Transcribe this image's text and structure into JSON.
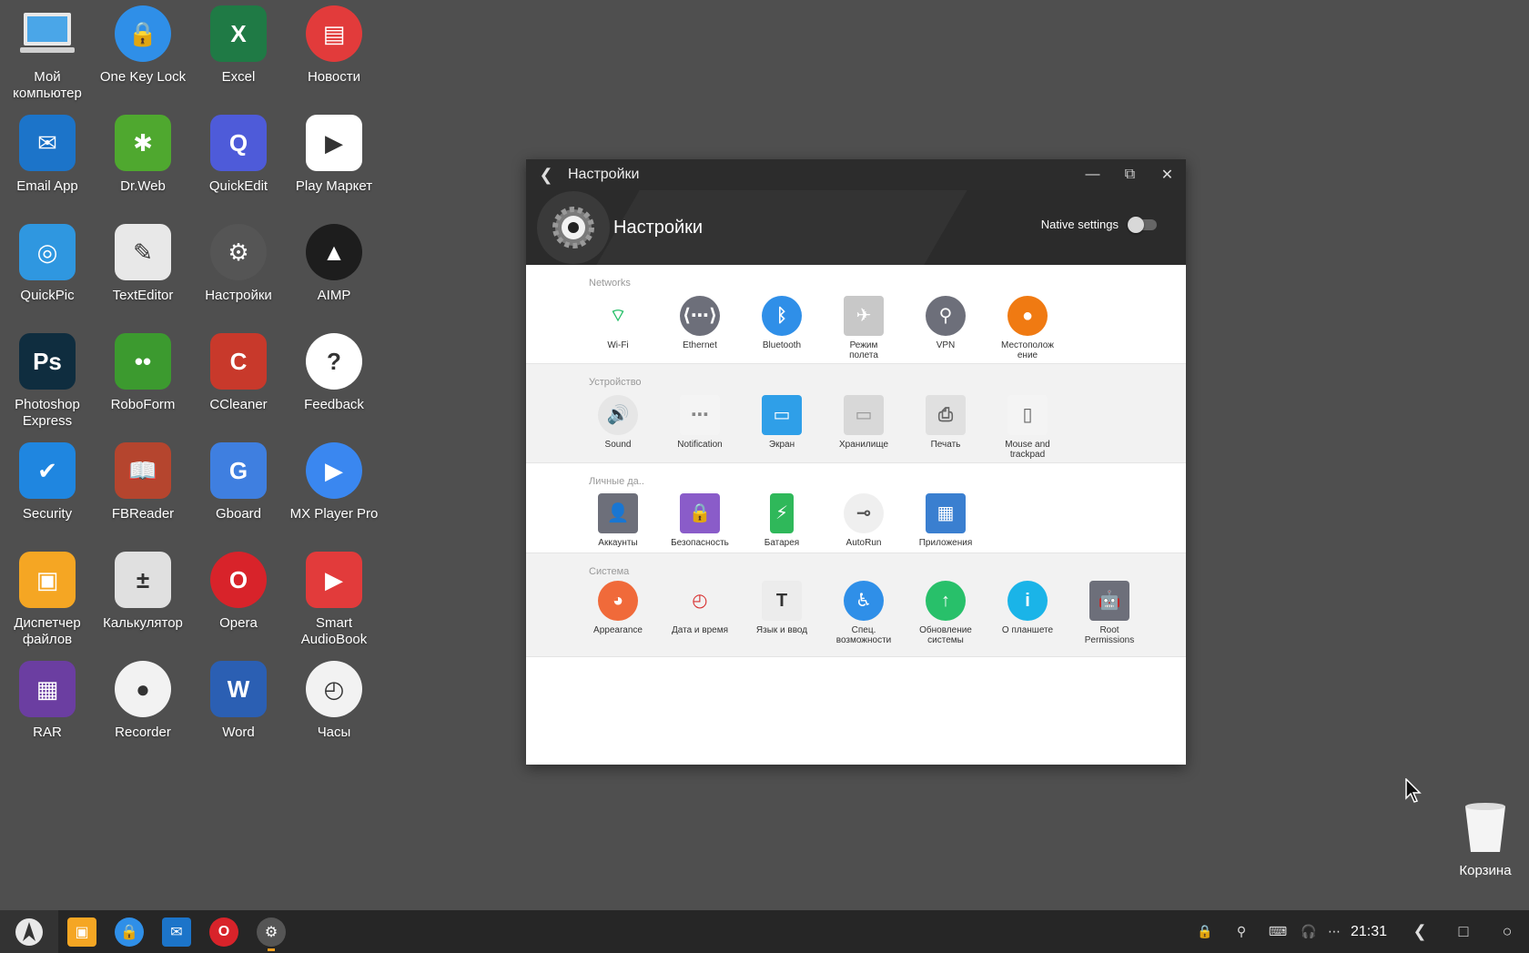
{
  "desktop": {
    "icons": [
      {
        "label": "Мой\nкомпьютер",
        "icon": "computer-icon",
        "color": "#4aa6e8"
      },
      {
        "label": "One Key Lock",
        "icon": "lock-icon",
        "color": "#2f8fe8"
      },
      {
        "label": "Excel",
        "icon": "excel-icon",
        "color": "#1f7a45"
      },
      {
        "label": "Новости",
        "icon": "news-icon",
        "color": "#e23b3b"
      },
      {
        "label": "Email App",
        "icon": "mail-icon",
        "color": "#1c74c9"
      },
      {
        "label": "Dr.Web",
        "icon": "spider-icon",
        "color": "#4fa82f"
      },
      {
        "label": "QuickEdit",
        "icon": "edit-icon",
        "color": "#4e5bd9"
      },
      {
        "label": "Play Маркет",
        "icon": "play-store-icon",
        "color": "#ffffff"
      },
      {
        "label": "QuickPic",
        "icon": "picture-icon",
        "color": "#2f97e0"
      },
      {
        "label": "TextEditor",
        "icon": "pen-icon",
        "color": "#e8e8e8"
      },
      {
        "label": "Настройки",
        "icon": "gear-icon",
        "color": "#555555"
      },
      {
        "label": "AIMP",
        "icon": "aimp-icon",
        "color": "#1d1d1d"
      },
      {
        "label": "Photoshop\nExpress",
        "icon": "photoshop-icon",
        "color": "#0f2d3f"
      },
      {
        "label": "RoboForm",
        "icon": "roboform-icon",
        "color": "#3c9a2f"
      },
      {
        "label": "CCleaner",
        "icon": "ccleaner-icon",
        "color": "#c8392b"
      },
      {
        "label": "Feedback",
        "icon": "question-icon",
        "color": "#ffffff"
      },
      {
        "label": "Security",
        "icon": "shield-icon",
        "color": "#1f86e0"
      },
      {
        "label": "FBReader",
        "icon": "book-icon",
        "color": "#b5452e"
      },
      {
        "label": "Gboard",
        "icon": "keyboard-icon",
        "color": "#3f7fe0"
      },
      {
        "label": "MX Player Pro",
        "icon": "play-icon",
        "color": "#3a87f0"
      },
      {
        "label": "Диспетчер\nфайлов",
        "icon": "folder-icon",
        "color": "#f5a623"
      },
      {
        "label": "Калькулятор",
        "icon": "calculator-icon",
        "color": "#e0e0e0"
      },
      {
        "label": "Opera",
        "icon": "opera-icon",
        "color": "#d8232a"
      },
      {
        "label": "Smart\nAudioBook",
        "icon": "audiobook-icon",
        "color": "#e23b3b"
      },
      {
        "label": "RAR",
        "icon": "rar-icon",
        "color": "#6b3ea1"
      },
      {
        "label": "Recorder",
        "icon": "recorder-icon",
        "color": "#f2f2f2"
      },
      {
        "label": "Word",
        "icon": "word-icon",
        "color": "#2b5fb3"
      },
      {
        "label": "Часы",
        "icon": "clock-icon",
        "color": "#f2f2f2"
      }
    ],
    "trash_label": "Корзина"
  },
  "window": {
    "title": "Настройки",
    "header_title": "Настройки",
    "native_settings_label": "Native settings",
    "native_settings_on": false,
    "sections": [
      {
        "title": "Networks",
        "items": [
          {
            "label": "Wi-Fi",
            "icon": "wifi-icon"
          },
          {
            "label": "Ethernet",
            "icon": "ethernet-icon"
          },
          {
            "label": "Bluetooth",
            "icon": "bluetooth-icon"
          },
          {
            "label": "Режим\nполета",
            "icon": "airplane-mode-icon"
          },
          {
            "label": "VPN",
            "icon": "vpn-icon"
          },
          {
            "label": "Местополож\nение",
            "icon": "location-icon"
          }
        ]
      },
      {
        "title": "Устройство",
        "items": [
          {
            "label": "Sound",
            "icon": "sound-icon"
          },
          {
            "label": "Notification",
            "icon": "notification-icon"
          },
          {
            "label": "Экран",
            "icon": "display-icon"
          },
          {
            "label": "Хранилище",
            "icon": "storage-icon"
          },
          {
            "label": "Печать",
            "icon": "printer-icon"
          },
          {
            "label": "Mouse and\ntrackpad",
            "icon": "mouse-icon"
          }
        ]
      },
      {
        "title": "Личные да..",
        "items": [
          {
            "label": "Аккаунты",
            "icon": "account-icon"
          },
          {
            "label": "Безопасность",
            "icon": "security-lock-icon"
          },
          {
            "label": "Батарея",
            "icon": "battery-icon"
          },
          {
            "label": "AutoRun",
            "icon": "autorun-icon"
          },
          {
            "label": "Приложения",
            "icon": "apps-icon"
          }
        ]
      },
      {
        "title": "Система",
        "items": [
          {
            "label": "Appearance",
            "icon": "appearance-icon"
          },
          {
            "label": "Дата и время",
            "icon": "clock-icon"
          },
          {
            "label": "Язык и ввод",
            "icon": "language-icon"
          },
          {
            "label": "Спец.\nвозможности",
            "icon": "accessibility-icon"
          },
          {
            "label": "Обновление\nсистемы",
            "icon": "update-icon"
          },
          {
            "label": "О планшете",
            "icon": "info-icon"
          },
          {
            "label": "Root\nPermissions",
            "icon": "android-icon"
          }
        ]
      }
    ]
  },
  "taskbar": {
    "apps": [
      {
        "name": "file-manager",
        "icon": "folder-icon",
        "color": "#f5a623"
      },
      {
        "name": "one-key-lock",
        "icon": "lock-icon",
        "color": "#2f8fe8"
      },
      {
        "name": "email-app",
        "icon": "mail-icon",
        "color": "#1c74c9"
      },
      {
        "name": "opera",
        "icon": "opera-icon",
        "color": "#d8232a"
      },
      {
        "name": "settings",
        "icon": "gear-icon",
        "color": "#555555"
      }
    ],
    "clock": "21:31"
  }
}
